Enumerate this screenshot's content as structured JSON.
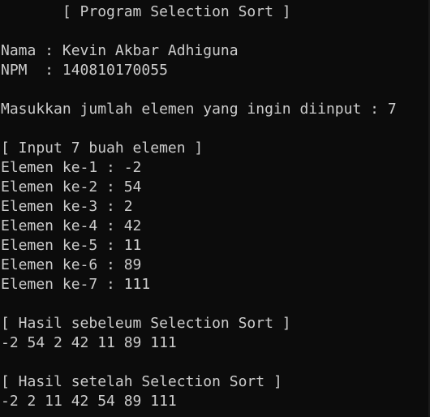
{
  "console": {
    "title_line": "       [ Program Selection Sort ]",
    "nama": "Nama : Kevin Akbar Adhiguna",
    "npm": "NPM  : 140810170055",
    "prompt": "Masukkan jumlah elemen yang ingin diinput : 7",
    "input_header": "[ Input 7 buah elemen ]",
    "elements": [
      "Elemen ke-1 : -2",
      "Elemen ke-2 : 54",
      "Elemen ke-3 : 2",
      "Elemen ke-4 : 42",
      "Elemen ke-5 : 11",
      "Elemen ke-6 : 89",
      "Elemen ke-7 : 111"
    ],
    "before_header": "[ Hasil sebeleum Selection Sort ]",
    "before_values": "-2 54 2 42 11 89 111",
    "after_header": "[ Hasil setelah Selection Sort ]",
    "after_values": "-2 2 11 42 54 89 111"
  },
  "colors": {
    "background": "#0c0c0c",
    "text": "#cccccc"
  }
}
